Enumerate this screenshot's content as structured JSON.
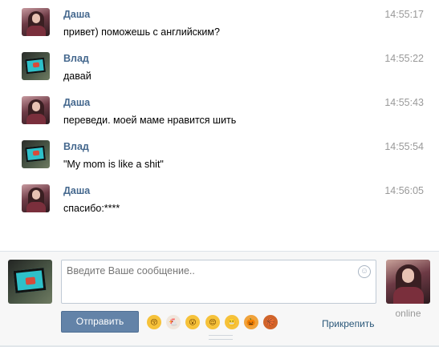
{
  "messages": [
    {
      "author": "Даша",
      "text": "привет) поможешь с английским?",
      "time": "14:55:17",
      "avatar": "dasha"
    },
    {
      "author": "Влад",
      "text": "давай",
      "time": "14:55:22",
      "avatar": "vlad"
    },
    {
      "author": "Даша",
      "text": "переведи. моей маме нравится шить",
      "time": "14:55:43",
      "avatar": "dasha"
    },
    {
      "author": "Влад",
      "text": "\"My mom is like a shit\"",
      "time": "14:55:54",
      "avatar": "vlad"
    },
    {
      "author": "Даша",
      "text": "спасибо:****",
      "time": "14:56:05",
      "avatar": "dasha"
    }
  ],
  "composer": {
    "placeholder": "Введите Ваше сообщение..",
    "send_label": "Отправить",
    "attach_label": "Прикрепить",
    "peer_status": "online",
    "emoji": [
      "face-kiss-icon",
      "chicken-icon",
      "face-surprised-icon",
      "face-relieved-icon",
      "face-grimace-icon",
      "pumpkin-icon",
      "basketball-icon"
    ]
  },
  "colors": {
    "name": "#45688e",
    "time": "#999999",
    "send_button": "#6383a8",
    "link": "#2b587a"
  }
}
